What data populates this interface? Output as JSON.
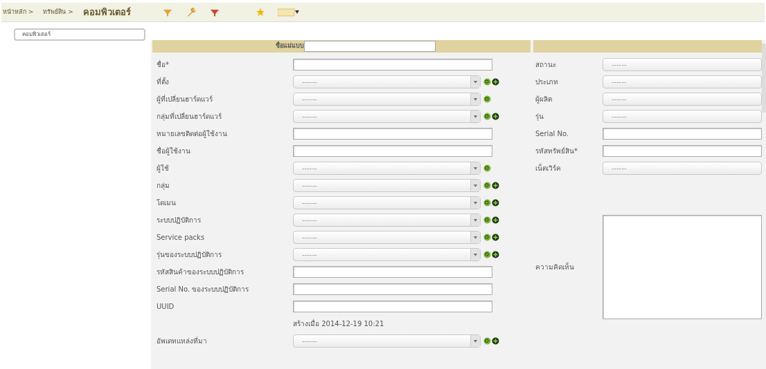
{
  "breadcrumb": [
    {
      "kind": "link",
      "label": "หน้าหลัก >"
    },
    {
      "kind": "link",
      "label": "ทรัพย์สิน >"
    },
    {
      "kind": "current",
      "label": "คอมพิวเตอร์"
    }
  ],
  "sidebar": {
    "items": [
      {
        "label": "คอมพิวเตอร์",
        "selected": true
      }
    ]
  },
  "form": {
    "template_label": "ชื่อแม่แบบ",
    "left_fields": [
      {
        "kind": "text",
        "label": "ชื่อ*"
      },
      {
        "kind": "select",
        "label": "ที่ตั้ง",
        "value": "------",
        "search": true,
        "add": true
      },
      {
        "kind": "select",
        "label": "ผู้ที่เปลี่ยนฮาร์ดแวร์",
        "value": "------",
        "search": true,
        "add": false
      },
      {
        "kind": "select",
        "label": "กลุ่มที่เปลี่ยนฮาร์ดแวร์",
        "value": "------",
        "search": true,
        "add": true
      },
      {
        "kind": "text",
        "label": "หมายเลขติดต่อผู้ใช้งาน"
      },
      {
        "kind": "text",
        "label": "ชื่อผู้ใช้งาน"
      },
      {
        "kind": "select",
        "label": "ผู้ใช้",
        "value": "------",
        "search": true,
        "add": false
      },
      {
        "kind": "select",
        "label": "กลุ่ม",
        "value": "------",
        "search": true,
        "add": true
      },
      {
        "kind": "select",
        "label": "โดเมน",
        "value": "------",
        "search": true,
        "add": true
      },
      {
        "kind": "select",
        "label": "ระบบปฏิบัติการ",
        "value": "------",
        "search": true,
        "add": true
      },
      {
        "kind": "select",
        "label": "Service packs",
        "value": "------",
        "search": true,
        "add": true
      },
      {
        "kind": "select",
        "label": "รุ่นของระบบปฏิบัติการ",
        "value": "------",
        "search": true,
        "add": true
      },
      {
        "kind": "text",
        "label": "รหัสสินค้าของระบบปฏิบัติการ"
      },
      {
        "kind": "text",
        "label": "Serial No. ของระบบปฏิบัติการ"
      },
      {
        "kind": "text",
        "label": "UUID"
      },
      {
        "kind": "info",
        "text": "สร้างเมื่อ 2014-12-19 10:21"
      },
      {
        "kind": "select",
        "label": "อัพเดทแหล่งที่มา",
        "value": "------",
        "search": true,
        "add": true
      }
    ],
    "right_fields": [
      {
        "kind": "select",
        "label": "สถานะ",
        "value": "------"
      },
      {
        "kind": "select",
        "label": "ประเภท",
        "value": "------"
      },
      {
        "kind": "select",
        "label": "ผู้ผลิต",
        "value": "------"
      },
      {
        "kind": "select",
        "label": "รุ่น",
        "value": "------"
      },
      {
        "kind": "text",
        "label": "Serial No."
      },
      {
        "kind": "text",
        "label": "รหัสทรัพย์สิน*"
      },
      {
        "kind": "select",
        "label": "เน็ตเวิร์ค",
        "value": "------"
      }
    ],
    "comment_label": "ความคิดเห็น"
  }
}
